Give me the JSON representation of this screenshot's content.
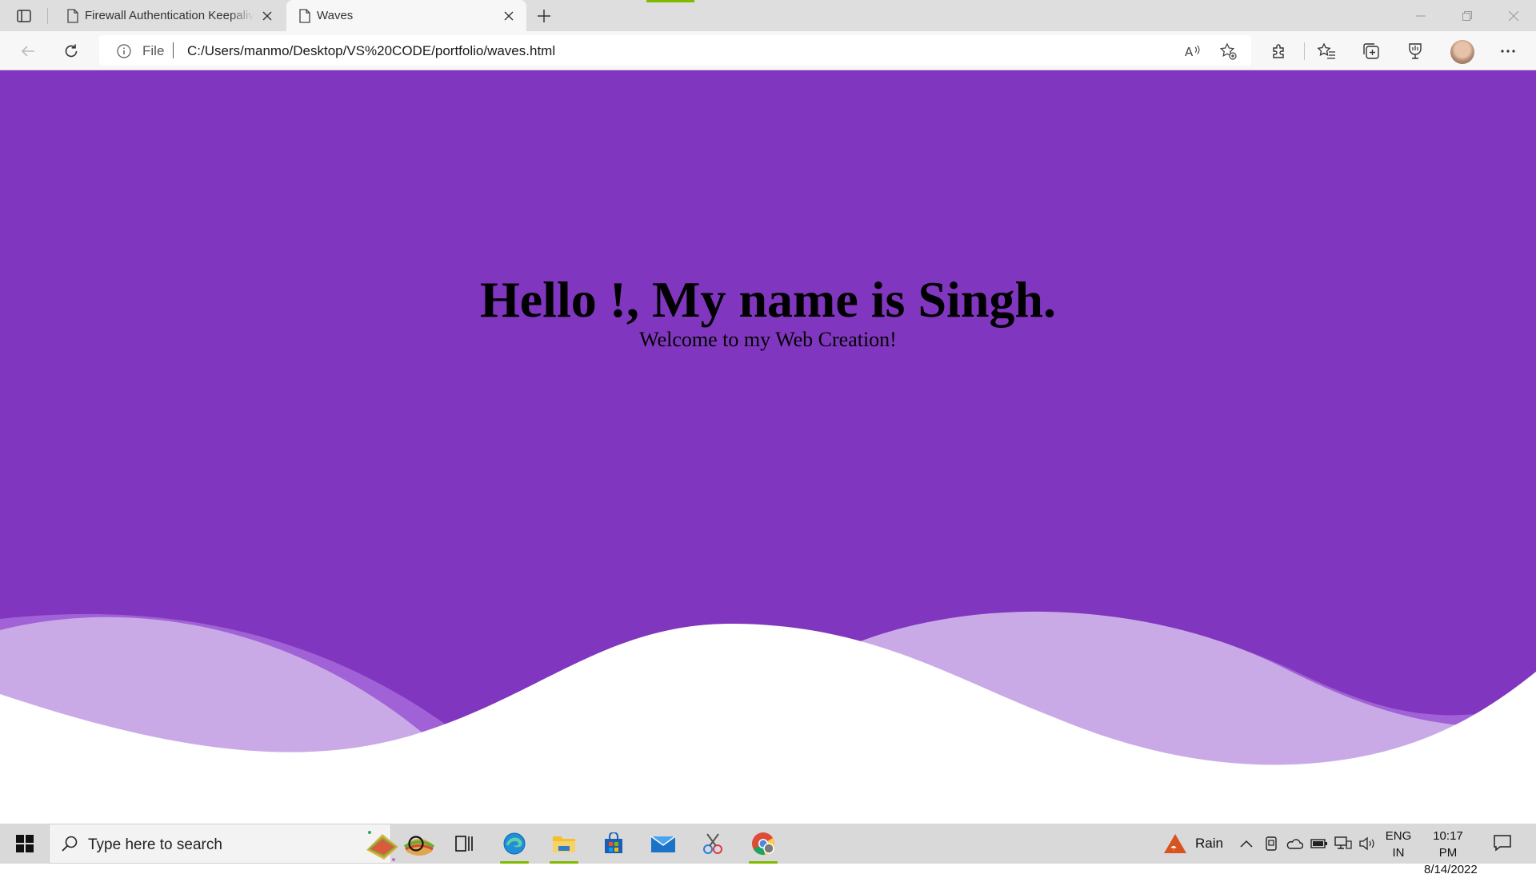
{
  "browser": {
    "tabs": [
      {
        "title": "Firewall Authentication Keepalive",
        "active": false
      },
      {
        "title": "Waves",
        "active": true
      }
    ],
    "address": {
      "scheme_label": "File",
      "url": "C:/Users/manmo/Desktop/VS%20CODE/portfolio/waves.html"
    }
  },
  "page": {
    "title": "Hello !, My name is Singh.",
    "subtitle": "Welcome to my Web Creation!",
    "colors": {
      "background": "#8036be",
      "wave_light": "#c9aae6",
      "wave_mid": "#a062d6",
      "wave_front": "#ffffff"
    }
  },
  "taskbar": {
    "search_placeholder": "Type here to search",
    "weather": "Rain",
    "lang_line1": "ENG",
    "lang_line2": "IN",
    "time": "10:17 PM",
    "date": "8/14/2022",
    "apps": [
      "cortana-icon",
      "task-view-icon",
      "edge-icon",
      "file-explorer-icon",
      "store-icon",
      "mail-icon",
      "snipping-tool-icon",
      "chrome-icon"
    ]
  }
}
